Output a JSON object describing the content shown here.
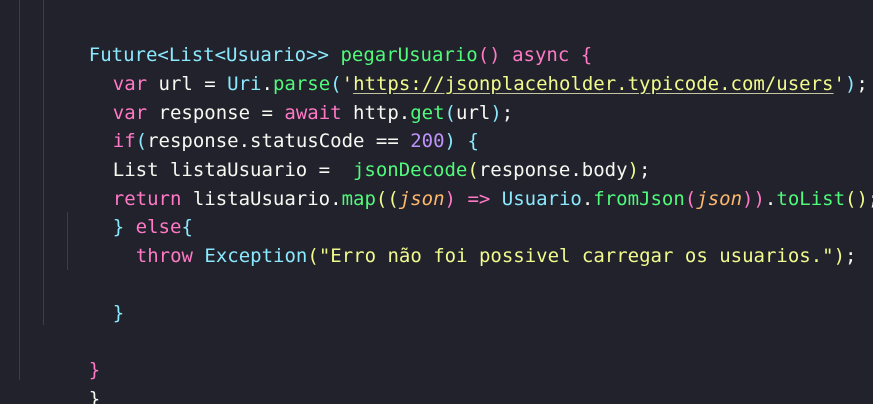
{
  "code": {
    "line1": {
      "t1": "Future<List<Usuario>>",
      "t2": " ",
      "t3": "pegarUsuario",
      "t4": "()",
      "t5": " ",
      "t6": "async",
      "t7": " ",
      "t8": "{"
    },
    "line2": {
      "t1": "var",
      "t2": " url = ",
      "t3": "Uri",
      "t4": ".",
      "t5": "parse",
      "t6": "(",
      "t7": "'",
      "t8": "https://jsonplaceholder.typicode.com/users",
      "t9": "'",
      "t10": ")",
      "t11": ";"
    },
    "line3": {
      "t1": "var",
      "t2": " response = ",
      "t3": "await",
      "t4": " http.",
      "t5": "get",
      "t6": "(",
      "t7": "url",
      "t8": ")",
      "t9": ";"
    },
    "line4": {
      "t1": "if",
      "t2": "(",
      "t3": "response.statusCode == ",
      "t4": "200",
      "t5": ")",
      "t6": " ",
      "t7": "{"
    },
    "line5": {
      "t1": "List listaUsuario =  ",
      "t2": "jsonDecode",
      "t3": "(",
      "t4": "response.body",
      "t5": ")",
      "t6": ";"
    },
    "line6": {
      "t1": "return",
      "t2": " listaUsuario.",
      "t3": "map",
      "t4": "((",
      "t5": "json",
      "t6": ")",
      "t7": " => ",
      "t8": "Usuario",
      "t9": ".",
      "t10": "fromJson",
      "t11": "(",
      "t12": "json",
      "t13": "))",
      "t14": ".",
      "t15": "toList",
      "t16": "()",
      "t17": ";"
    },
    "line7": {
      "t1": "}",
      "t2": " ",
      "t3": "else",
      "t4": "{"
    },
    "line8": {
      "t1": "throw",
      "t2": " ",
      "t3": "Exception",
      "t4": "(",
      "t5": "\"Erro não foi possivel carregar os usuarios.\"",
      "t6": ")",
      "t7": ";"
    },
    "line9": {
      "t1": "}"
    },
    "line10": {
      "t1": "}"
    },
    "line11": {
      "t1": "}"
    }
  },
  "theme": {
    "background": "#21222c",
    "keyword": "#ff79c6",
    "function": "#50fa7b",
    "type": "#8be9fd",
    "string": "#f1fa8c",
    "number": "#bd93f9",
    "parameter": "#ffb86c",
    "text": "#f8f8f2"
  }
}
